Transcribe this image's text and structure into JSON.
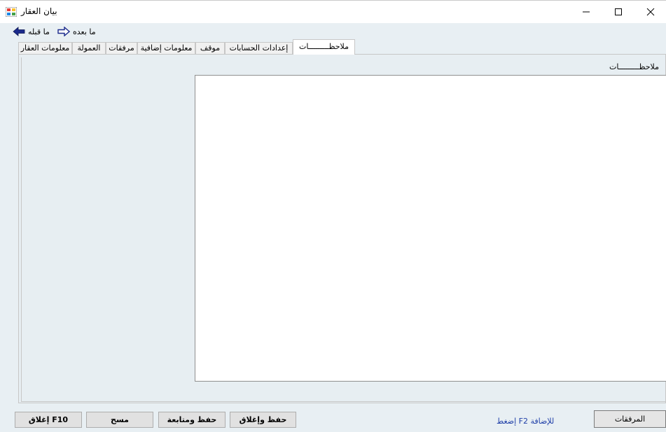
{
  "window": {
    "title": "بيان العقار"
  },
  "nav": {
    "prev_label": "ما قبله",
    "next_label": "ما بعده"
  },
  "tabs": [
    {
      "label": "معلومات العقار",
      "active": false
    },
    {
      "label": "العمولة",
      "active": false
    },
    {
      "label": "مرفقات",
      "active": false
    },
    {
      "label": "معلومات إضافية",
      "active": false
    },
    {
      "label": "موقف",
      "active": false
    },
    {
      "label": "إعدادات الحسابات",
      "active": false
    },
    {
      "label": "ملاحظـــــــــات",
      "active": true
    }
  ],
  "notes": {
    "label": "ملاحظـــــــــات",
    "value": ""
  },
  "footer": {
    "close_label": "إغلاق F10",
    "clear_label": "مسح",
    "save_continue_label": "حفظ ومتابعة",
    "save_close_label": "حفظ وإغلاق",
    "hint": "إضغط F2 للإضافة",
    "attachments_label": "المرفقات"
  },
  "colors": {
    "background": "#e8eff3",
    "hint_text": "#1f3fa8"
  }
}
